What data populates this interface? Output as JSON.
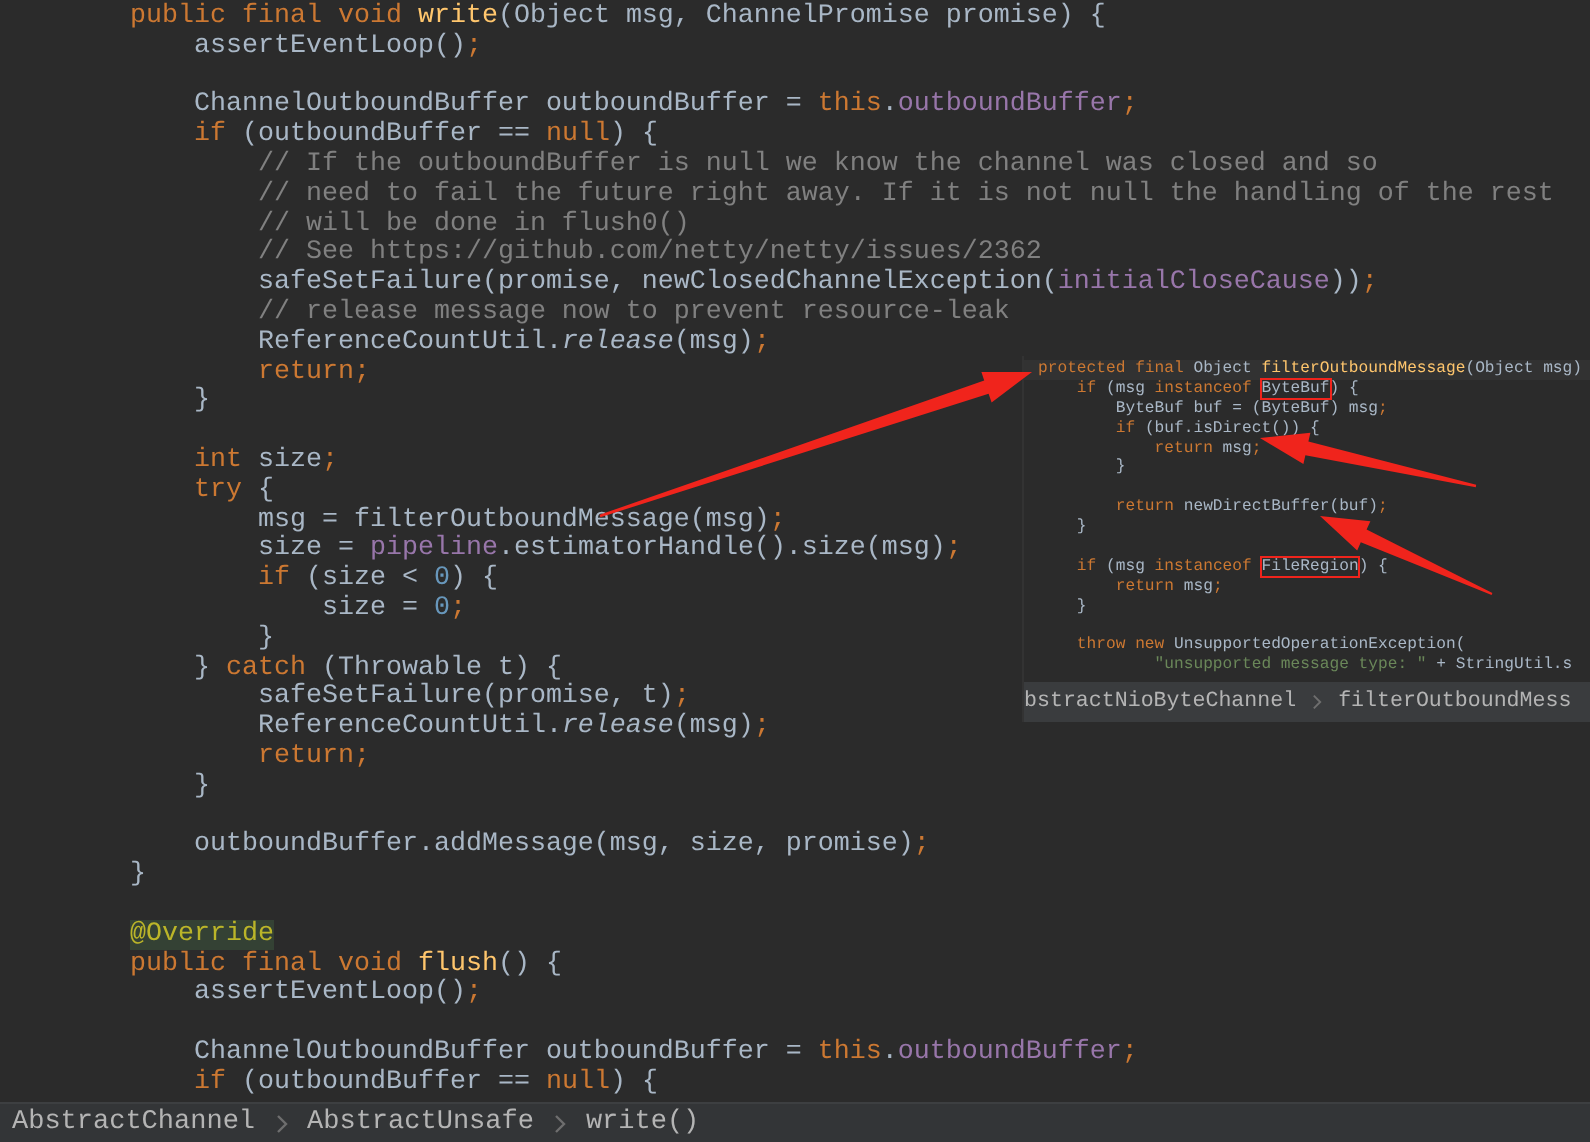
{
  "editor": {
    "lines": [
      {
        "kind": "code",
        "tokens": [
          {
            "kind": "keyword",
            "text": "        public final void "
          },
          {
            "kind": "method",
            "text": "write"
          },
          {
            "kind": "plain",
            "text": "(Object msg, ChannelPromise promise) {"
          }
        ]
      },
      {
        "kind": "code",
        "tokens": [
          {
            "kind": "plain",
            "text": "            assertEventLoop()"
          },
          {
            "kind": "keyword",
            "text": ";"
          }
        ]
      },
      {
        "kind": "blank"
      },
      {
        "kind": "code",
        "tokens": [
          {
            "kind": "plain",
            "text": "            ChannelOutboundBuffer outboundBuffer = "
          },
          {
            "kind": "keyword",
            "text": "this"
          },
          {
            "kind": "plain",
            "text": "."
          },
          {
            "kind": "field",
            "text": "outboundBuffer"
          },
          {
            "kind": "keyword",
            "text": ";"
          }
        ]
      },
      {
        "kind": "code",
        "tokens": [
          {
            "kind": "keyword",
            "text": "            if "
          },
          {
            "kind": "plain",
            "text": "(outboundBuffer == "
          },
          {
            "kind": "keyword",
            "text": "null"
          },
          {
            "kind": "plain",
            "text": ") {"
          }
        ]
      },
      {
        "kind": "code",
        "tokens": [
          {
            "kind": "comment",
            "text": "                // If the outboundBuffer is null we know the channel was closed and so"
          }
        ]
      },
      {
        "kind": "code",
        "tokens": [
          {
            "kind": "comment",
            "text": "                // need to fail the future right away. If it is not null the handling of the rest"
          }
        ]
      },
      {
        "kind": "code",
        "tokens": [
          {
            "kind": "comment",
            "text": "                // will be done in flush0()"
          }
        ]
      },
      {
        "kind": "code",
        "tokens": [
          {
            "kind": "comment",
            "text": "                // See https://github.com/netty/netty/issues/2362"
          }
        ]
      },
      {
        "kind": "code",
        "tokens": [
          {
            "kind": "plain",
            "text": "                safeSetFailure(promise, newClosedChannelException("
          },
          {
            "kind": "field",
            "text": "initialCloseCause"
          },
          {
            "kind": "plain",
            "text": "))"
          },
          {
            "kind": "keyword",
            "text": ";"
          }
        ]
      },
      {
        "kind": "code",
        "tokens": [
          {
            "kind": "comment",
            "text": "                // release message now to prevent resource-leak"
          }
        ]
      },
      {
        "kind": "code",
        "tokens": [
          {
            "kind": "plain",
            "text": "                ReferenceCountUtil."
          },
          {
            "kind": "italic",
            "text": "release"
          },
          {
            "kind": "plain",
            "text": "(msg)"
          },
          {
            "kind": "keyword",
            "text": ";"
          }
        ]
      },
      {
        "kind": "code",
        "tokens": [
          {
            "kind": "keyword",
            "text": "                return;"
          }
        ]
      },
      {
        "kind": "code",
        "tokens": [
          {
            "kind": "plain",
            "text": "            }"
          }
        ]
      },
      {
        "kind": "blank"
      },
      {
        "kind": "code",
        "tokens": [
          {
            "kind": "keyword",
            "text": "            int "
          },
          {
            "kind": "plain",
            "text": "size"
          },
          {
            "kind": "keyword",
            "text": ";"
          }
        ]
      },
      {
        "kind": "code",
        "tokens": [
          {
            "kind": "keyword",
            "text": "            try "
          },
          {
            "kind": "plain",
            "text": "{"
          }
        ]
      },
      {
        "kind": "code",
        "tokens": [
          {
            "kind": "plain",
            "text": "                msg = filterOutboundMessage(msg)"
          },
          {
            "kind": "keyword",
            "text": ";"
          }
        ]
      },
      {
        "kind": "code",
        "tokens": [
          {
            "kind": "plain",
            "text": "                size = "
          },
          {
            "kind": "field",
            "text": "pipeline"
          },
          {
            "kind": "plain",
            "text": ".estimatorHandle().size(msg)"
          },
          {
            "kind": "keyword",
            "text": ";"
          }
        ]
      },
      {
        "kind": "code",
        "tokens": [
          {
            "kind": "keyword",
            "text": "                if "
          },
          {
            "kind": "plain",
            "text": "(size < "
          },
          {
            "kind": "number",
            "text": "0"
          },
          {
            "kind": "plain",
            "text": ") {"
          }
        ]
      },
      {
        "kind": "code",
        "tokens": [
          {
            "kind": "plain",
            "text": "                    size = "
          },
          {
            "kind": "number",
            "text": "0"
          },
          {
            "kind": "keyword",
            "text": ";"
          }
        ]
      },
      {
        "kind": "code",
        "tokens": [
          {
            "kind": "plain",
            "text": "                }"
          }
        ]
      },
      {
        "kind": "code",
        "tokens": [
          {
            "kind": "plain",
            "text": "            } "
          },
          {
            "kind": "keyword",
            "text": "catch "
          },
          {
            "kind": "plain",
            "text": "(Throwable t) {"
          }
        ]
      },
      {
        "kind": "code",
        "tokens": [
          {
            "kind": "plain",
            "text": "                safeSetFailure(promise, t)"
          },
          {
            "kind": "keyword",
            "text": ";"
          }
        ]
      },
      {
        "kind": "code",
        "tokens": [
          {
            "kind": "plain",
            "text": "                ReferenceCountUtil."
          },
          {
            "kind": "italic",
            "text": "release"
          },
          {
            "kind": "plain",
            "text": "(msg)"
          },
          {
            "kind": "keyword",
            "text": ";"
          }
        ]
      },
      {
        "kind": "code",
        "tokens": [
          {
            "kind": "keyword",
            "text": "                return;"
          }
        ]
      },
      {
        "kind": "code",
        "tokens": [
          {
            "kind": "plain",
            "text": "            }"
          }
        ]
      },
      {
        "kind": "blank"
      },
      {
        "kind": "code",
        "tokens": [
          {
            "kind": "plain",
            "text": "            outboundBuffer.addMessage(msg, size, promise)"
          },
          {
            "kind": "keyword",
            "text": ";"
          }
        ]
      },
      {
        "kind": "code",
        "tokens": [
          {
            "kind": "plain",
            "text": "        }"
          }
        ]
      },
      {
        "kind": "blank"
      },
      {
        "kind": "code",
        "tokens": [
          {
            "kind": "annotation",
            "text": "        @Override"
          }
        ]
      },
      {
        "kind": "code",
        "tokens": [
          {
            "kind": "keyword",
            "text": "        public final void "
          },
          {
            "kind": "method",
            "text": "flush"
          },
          {
            "kind": "plain",
            "text": "() {"
          }
        ]
      },
      {
        "kind": "code",
        "tokens": [
          {
            "kind": "plain",
            "text": "            assertEventLoop()"
          },
          {
            "kind": "keyword",
            "text": ";"
          }
        ]
      },
      {
        "kind": "blank"
      },
      {
        "kind": "code",
        "tokens": [
          {
            "kind": "plain",
            "text": "            ChannelOutboundBuffer outboundBuffer = "
          },
          {
            "kind": "keyword",
            "text": "this"
          },
          {
            "kind": "plain",
            "text": "."
          },
          {
            "kind": "field",
            "text": "outboundBuffer"
          },
          {
            "kind": "keyword",
            "text": ";"
          }
        ]
      },
      {
        "kind": "code",
        "tokens": [
          {
            "kind": "keyword",
            "text": "            if "
          },
          {
            "kind": "plain",
            "text": "(outboundBuffer == "
          },
          {
            "kind": "keyword",
            "text": "null"
          },
          {
            "kind": "plain",
            "text": ") {"
          }
        ]
      }
    ]
  },
  "inset": {
    "lines": [
      {
        "kind": "code",
        "highlighted": true,
        "tokens": [
          {
            "kind": "keyword",
            "text": "protected final "
          },
          {
            "kind": "plain",
            "text": "Object "
          },
          {
            "kind": "method",
            "text": "filterOutboundMessage"
          },
          {
            "kind": "plain",
            "text": "(Object msg)"
          }
        ]
      },
      {
        "kind": "code",
        "highlighted": false,
        "tokens": [
          {
            "kind": "keyword",
            "text": "    if "
          },
          {
            "kind": "plain",
            "text": "(msg "
          },
          {
            "kind": "keyword",
            "text": "instanceof "
          },
          {
            "kind": "boxed",
            "text": "ByteBuf"
          },
          {
            "kind": "plain",
            "text": ") {"
          }
        ]
      },
      {
        "kind": "code",
        "highlighted": false,
        "tokens": [
          {
            "kind": "plain",
            "text": "        ByteBuf buf = (ByteBuf) msg"
          },
          {
            "kind": "keyword",
            "text": ";"
          }
        ]
      },
      {
        "kind": "code",
        "highlighted": false,
        "tokens": [
          {
            "kind": "keyword",
            "text": "        if "
          },
          {
            "kind": "plain",
            "text": "(buf.isDirect()) {"
          }
        ]
      },
      {
        "kind": "code",
        "highlighted": false,
        "tokens": [
          {
            "kind": "keyword",
            "text": "            return "
          },
          {
            "kind": "plain",
            "text": "msg"
          },
          {
            "kind": "keyword",
            "text": ";"
          }
        ]
      },
      {
        "kind": "code",
        "highlighted": false,
        "tokens": [
          {
            "kind": "plain",
            "text": "        }"
          }
        ]
      },
      {
        "kind": "blank",
        "highlighted": false
      },
      {
        "kind": "code",
        "highlighted": false,
        "tokens": [
          {
            "kind": "keyword",
            "text": "        return "
          },
          {
            "kind": "plain",
            "text": "newDirectBuffer(buf)"
          },
          {
            "kind": "keyword",
            "text": ";"
          }
        ]
      },
      {
        "kind": "code",
        "highlighted": false,
        "tokens": [
          {
            "kind": "plain",
            "text": "    }"
          }
        ]
      },
      {
        "kind": "blank",
        "highlighted": false
      },
      {
        "kind": "code",
        "highlighted": false,
        "tokens": [
          {
            "kind": "keyword",
            "text": "    if "
          },
          {
            "kind": "plain",
            "text": "(msg "
          },
          {
            "kind": "keyword",
            "text": "instanceof "
          },
          {
            "kind": "boxed",
            "text": "FileRegion"
          },
          {
            "kind": "plain",
            "text": ") {"
          }
        ]
      },
      {
        "kind": "code",
        "highlighted": false,
        "tokens": [
          {
            "kind": "keyword",
            "text": "        return "
          },
          {
            "kind": "plain",
            "text": "msg"
          },
          {
            "kind": "keyword",
            "text": ";"
          }
        ]
      },
      {
        "kind": "code",
        "highlighted": false,
        "tokens": [
          {
            "kind": "plain",
            "text": "    }"
          }
        ]
      },
      {
        "kind": "blank",
        "highlighted": false
      },
      {
        "kind": "code",
        "highlighted": false,
        "tokens": [
          {
            "kind": "keyword",
            "text": "    throw new "
          },
          {
            "kind": "plain",
            "text": "UnsupportedOperationException("
          }
        ]
      },
      {
        "kind": "code",
        "highlighted": false,
        "tokens": [
          {
            "kind": "string",
            "text": "            \"unsupported message type: \" "
          },
          {
            "kind": "plain",
            "text": "+ StringUtil.s"
          }
        ]
      }
    ],
    "breadcrumbs": [
      "bstractNioByteChannel",
      "filterOutboundMess"
    ]
  },
  "breadcrumbs": [
    "AbstractChannel",
    "AbstractUnsafe",
    "write()"
  ]
}
